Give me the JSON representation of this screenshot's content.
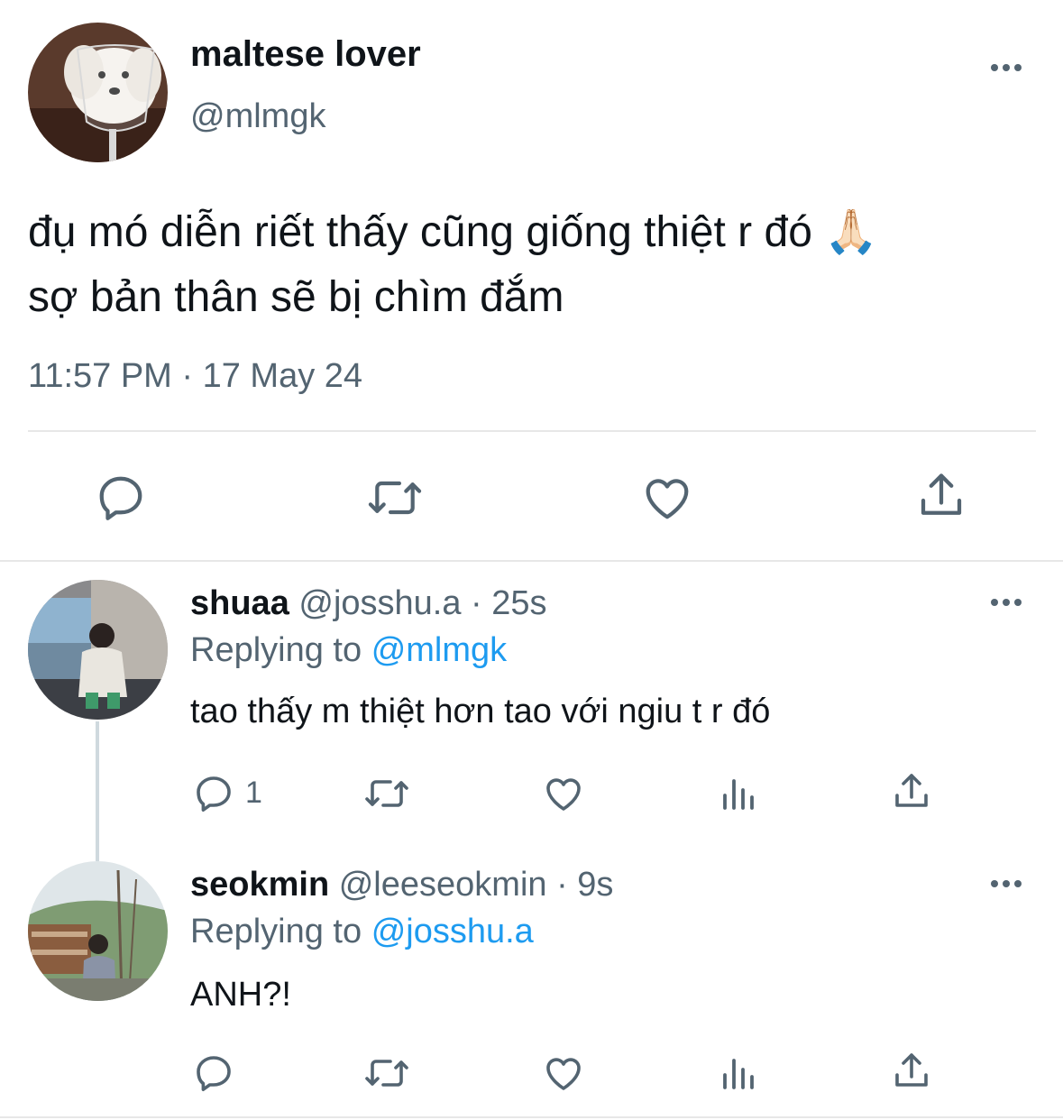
{
  "main_tweet": {
    "display_name": "maltese lover",
    "handle": "@mlmgk",
    "text_line1": "đụ mó diễn riết thấy cũng giống thiệt r đó 🙏🏻",
    "text_line2": "sợ bản thân sẽ bị chìm đắm",
    "timestamp": "11:57 PM · 17 May 24",
    "actions": [
      "reply-icon",
      "retweet-icon",
      "like-icon",
      "share-icon"
    ]
  },
  "replies": [
    {
      "display_name": "shuaa",
      "meta": "@josshu.a · 25s",
      "replying_label": "Replying to",
      "replying_to": "@mlmgk",
      "text": "tao thấy m thiệt hơn tao với ngiu t r đó",
      "reply_count": "1"
    },
    {
      "display_name": "seokmin",
      "meta": "@leeseokmin · 9s",
      "replying_label": "Replying to",
      "replying_to": "@josshu.a",
      "text": "ANH?!",
      "reply_count": ""
    }
  ],
  "colors": {
    "accent": "#1d9bf0",
    "muted": "#536471",
    "text": "#0f1419",
    "divider": "#e7e7e7"
  }
}
